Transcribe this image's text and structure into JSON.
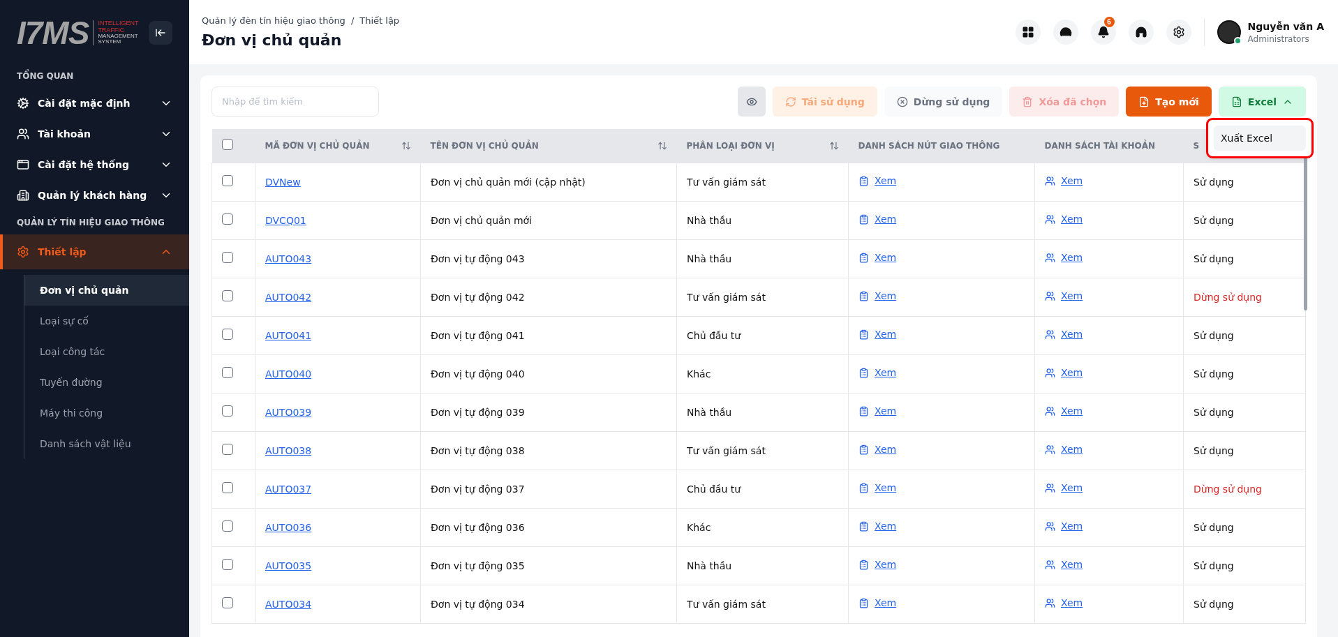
{
  "logo": {
    "mark": "I7MS",
    "tagline": [
      "INTELLIGENT",
      "TRAFFIC",
      "MANAGEMENT",
      "SYSTEM"
    ]
  },
  "sidebar": {
    "sections": [
      {
        "title": "TỔNG QUAN",
        "items": [
          {
            "label": "Cài đặt mặc định",
            "expanded": false,
            "selected": false
          },
          {
            "label": "Tài khoản",
            "expanded": false,
            "selected": false
          },
          {
            "label": "Cài đặt hệ thống",
            "expanded": false,
            "selected": false
          },
          {
            "label": "Quản lý khách hàng",
            "expanded": false,
            "selected": false
          }
        ]
      },
      {
        "title": "QUẢN LÝ TÍN HIỆU GIAO THÔNG",
        "items": [
          {
            "label": "Thiết lập",
            "expanded": true,
            "selected": true,
            "children": [
              {
                "label": "Đơn vị chủ quản",
                "selected": true
              },
              {
                "label": "Loại sự cố",
                "selected": false
              },
              {
                "label": "Loại công tác",
                "selected": false
              },
              {
                "label": "Tuyến đường",
                "selected": false
              },
              {
                "label": "Máy thi công",
                "selected": false
              },
              {
                "label": "Danh sách vật liệu",
                "selected": false
              }
            ]
          }
        ]
      }
    ]
  },
  "header": {
    "breadcrumb": [
      "Quản lý đèn tín hiệu giao thông",
      "Thiết lập"
    ],
    "separator": "/",
    "title": "Đơn vị chủ quản",
    "notification_count": "6",
    "user": {
      "name": "Nguyễn văn A",
      "role": "Administrators",
      "online": true
    }
  },
  "toolbar": {
    "search": {
      "placeholder": "Nhập để tìm kiếm"
    },
    "buttons": [
      {
        "kind": "view"
      },
      {
        "kind": "reuse",
        "label": "Tái sử dụng",
        "disabled": true
      },
      {
        "kind": "stop",
        "label": "Dừng sử dụng",
        "disabled": true
      },
      {
        "kind": "delete",
        "label": "Xóa đã chọn",
        "disabled": true
      },
      {
        "kind": "create",
        "label": "Tạo mới"
      },
      {
        "kind": "excel",
        "label": "Excel",
        "expanded": true
      }
    ],
    "dropdown": {
      "highlighted": true,
      "items": [
        {
          "label": "Xuất Excel",
          "hovered": true
        }
      ]
    }
  },
  "table": {
    "select_all": {
      "checked": false
    },
    "columns": [
      {
        "label": "MÃ ĐƠN VỊ CHỦ QUẢN",
        "sortable": true
      },
      {
        "label": "TÊN ĐƠN VỊ CHỦ QUẢN",
        "sortable": true
      },
      {
        "label": "PHÂN LOẠI ĐƠN VỊ",
        "sortable": true
      },
      {
        "label": "DANH SÁCH NÚT GIAO THÔNG",
        "sortable": false
      },
      {
        "label": "DANH SÁCH TÀI KHOẢN",
        "sortable": false
      },
      {
        "label": "S"
      }
    ],
    "rows": [
      {
        "checked": false,
        "code": "DVNew",
        "name": "Đơn vị chủ quản mới (cập nhật)",
        "type": "Tư vấn giám sát",
        "nodes": "Xem",
        "accounts": "Xem",
        "status": "Sử dụng",
        "active": true
      },
      {
        "checked": false,
        "code": "DVCQ01",
        "name": "Đơn vị chủ quản mới",
        "type": "Nhà thầu",
        "nodes": "Xem",
        "accounts": "Xem",
        "status": "Sử dụng",
        "active": true
      },
      {
        "checked": false,
        "code": "AUTO043",
        "name": "Đơn vị tự động 043",
        "type": "Nhà thầu",
        "nodes": "Xem",
        "accounts": "Xem",
        "status": "Sử dụng",
        "active": true
      },
      {
        "checked": false,
        "code": "AUTO042",
        "name": "Đơn vị tự động 042",
        "type": "Tư vấn giám sát",
        "nodes": "Xem",
        "accounts": "Xem",
        "status": "Dừng sử dụng",
        "active": false
      },
      {
        "checked": false,
        "code": "AUTO041",
        "name": "Đơn vị tự động 041",
        "type": "Chủ đầu tư",
        "nodes": "Xem",
        "accounts": "Xem",
        "status": "Sử dụng",
        "active": true
      },
      {
        "checked": false,
        "code": "AUTO040",
        "name": "Đơn vị tự động 040",
        "type": "Khác",
        "nodes": "Xem",
        "accounts": "Xem",
        "status": "Sử dụng",
        "active": true
      },
      {
        "checked": false,
        "code": "AUTO039",
        "name": "Đơn vị tự động 039",
        "type": "Nhà thầu",
        "nodes": "Xem",
        "accounts": "Xem",
        "status": "Sử dụng",
        "active": true
      },
      {
        "checked": false,
        "code": "AUTO038",
        "name": "Đơn vị tự động 038",
        "type": "Tư vấn giám sát",
        "nodes": "Xem",
        "accounts": "Xem",
        "status": "Sử dụng",
        "active": true
      },
      {
        "checked": false,
        "code": "AUTO037",
        "name": "Đơn vị tự động 037",
        "type": "Chủ đầu tư",
        "nodes": "Xem",
        "accounts": "Xem",
        "status": "Dừng sử dụng",
        "active": false
      },
      {
        "checked": false,
        "code": "AUTO036",
        "name": "Đơn vị tự động 036",
        "type": "Khác",
        "nodes": "Xem",
        "accounts": "Xem",
        "status": "Sử dụng",
        "active": true
      },
      {
        "checked": false,
        "code": "AUTO035",
        "name": "Đơn vị tự động 035",
        "type": "Nhà thầu",
        "nodes": "Xem",
        "accounts": "Xem",
        "status": "Sử dụng",
        "active": true
      },
      {
        "checked": false,
        "code": "AUTO034",
        "name": "Đơn vị tự động 034",
        "type": "Tư vấn giám sát",
        "nodes": "Xem",
        "accounts": "Xem",
        "status": "Sử dụng",
        "active": true
      }
    ]
  }
}
